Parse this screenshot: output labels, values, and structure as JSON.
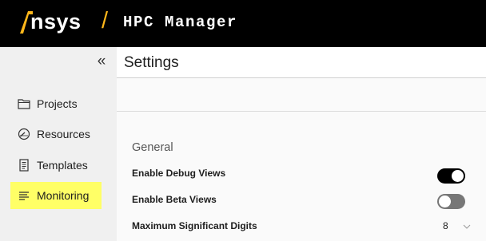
{
  "header": {
    "brand": "Ansys",
    "separator": "/",
    "app_title": "HPC Manager"
  },
  "sidebar": {
    "collapse_glyph": "«",
    "items": [
      {
        "label": "Projects",
        "icon": "folder-icon",
        "active": false
      },
      {
        "label": "Resources",
        "icon": "gauge-icon",
        "active": false
      },
      {
        "label": "Templates",
        "icon": "document-icon",
        "active": false
      },
      {
        "label": "Monitoring",
        "icon": "list-icon",
        "active": true
      }
    ]
  },
  "main": {
    "title": "Settings",
    "section": "General",
    "settings": [
      {
        "label": "Enable Debug Views",
        "type": "toggle",
        "value": true
      },
      {
        "label": "Enable Beta Views",
        "type": "toggle",
        "value": false
      },
      {
        "label": "Maximum Significant Digits",
        "type": "select",
        "value": "8"
      }
    ]
  },
  "colors": {
    "topbar_bg": "#000000",
    "brand_accent": "#ffb71b",
    "active_highlight": "#ffff66",
    "toggle_on": "#000000",
    "toggle_off": "#777777"
  }
}
